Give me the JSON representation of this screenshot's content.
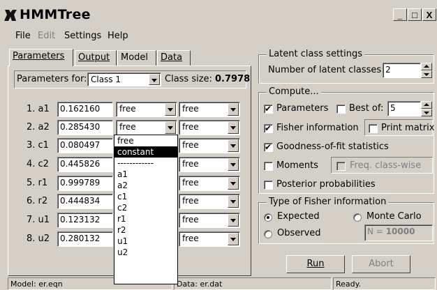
{
  "window": {
    "title": "HMMTree",
    "minimize": "_",
    "maximize": "□",
    "close": "X"
  },
  "menu": [
    {
      "label": "File",
      "enabled": true
    },
    {
      "label": "Edit",
      "enabled": false
    },
    {
      "label": "Settings",
      "enabled": true
    },
    {
      "label": "Help",
      "enabled": true
    }
  ],
  "tabs": [
    "Parameters",
    "Output",
    "Model",
    "Data"
  ],
  "params_panel": {
    "for_label": "Parameters for:",
    "class_selected": "Class 1",
    "class_size_label": "Class size:",
    "class_size_value": "0.7978",
    "rows": [
      {
        "label": "1. a1",
        "value": "0.162160",
        "c1": "free",
        "c2": "free"
      },
      {
        "label": "2. a2",
        "value": "0.285430",
        "c1": "free",
        "c2": "free"
      },
      {
        "label": "3. c1",
        "value": "0.080497",
        "c1": "",
        "c2": "free"
      },
      {
        "label": "4. c2",
        "value": "0.445826",
        "c1": "",
        "c2": "free"
      },
      {
        "label": "5. r1",
        "value": "0.999789",
        "c1": "",
        "c2": "free"
      },
      {
        "label": "6. r2",
        "value": "0.444834",
        "c1": "",
        "c2": "free"
      },
      {
        "label": "7. u1",
        "value": "0.123132",
        "c1": "",
        "c2": "free"
      },
      {
        "label": "8. u2",
        "value": "0.280132",
        "c1": "",
        "c2": "free"
      }
    ],
    "dropdown_options": [
      "free",
      "constant",
      "------------",
      "a1",
      "a2",
      "c1",
      "c2",
      "r1",
      "r2",
      "u1",
      "u2"
    ],
    "dropdown_selected_index": 1
  },
  "latent": {
    "title": "Latent class settings",
    "num_label": "Number of latent classes:",
    "num_value": "2"
  },
  "compute": {
    "title": "Compute...",
    "parameters": {
      "label": "Parameters",
      "checked": true
    },
    "best_of": {
      "label": "Best of:",
      "checked": false,
      "value": "5"
    },
    "fisher": {
      "label": "Fisher information",
      "checked": true
    },
    "print_matrix": {
      "label": "Print matrix",
      "checked": false
    },
    "goodness": {
      "label": "Goodness-of-fit statistics",
      "checked": true
    },
    "moments": {
      "label": "Moments",
      "checked": false
    },
    "freq_classwise": {
      "label": "Freq. class-wise",
      "checked": false
    },
    "posterior": {
      "label": "Posterior probabilities",
      "checked": false
    }
  },
  "fisher_type": {
    "title": "Type of Fisher information",
    "expected": "Expected",
    "monte_carlo": "Monte Carlo",
    "observed": "Observed",
    "n_label": "N =",
    "n_value": "10000",
    "selected": "expected"
  },
  "buttons": {
    "run": "Run",
    "abort": "Abort"
  },
  "status": {
    "model": "Model: er.eqn",
    "data": "Data: er.dat",
    "state": "Ready."
  }
}
